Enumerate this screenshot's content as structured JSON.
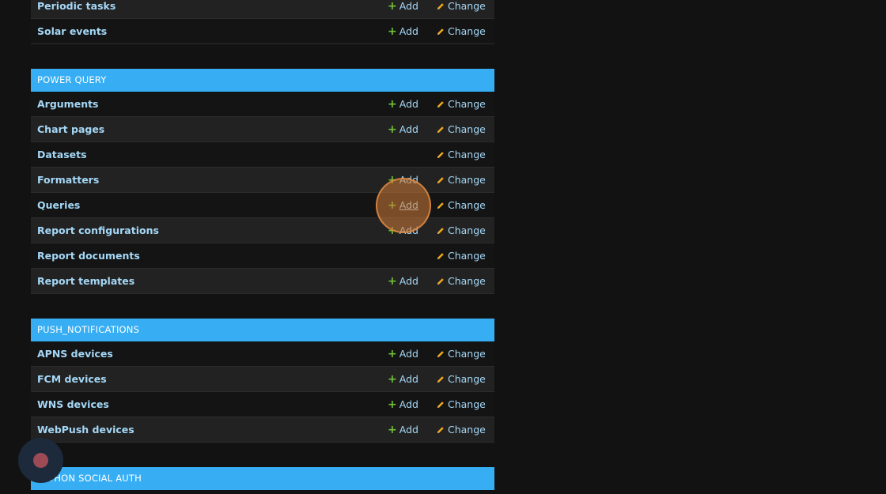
{
  "top_module": {
    "rows": [
      {
        "name": "Periodic tasks",
        "add": "Add",
        "change": "Change"
      },
      {
        "name": "Solar events",
        "add": "Add",
        "change": "Change"
      }
    ]
  },
  "power_query": {
    "title": "POWER QUERY",
    "rows": [
      {
        "name": "Arguments",
        "add": "Add",
        "change": "Change"
      },
      {
        "name": "Chart pages",
        "add": "Add",
        "change": "Change"
      },
      {
        "name": "Datasets",
        "change": "Change"
      },
      {
        "name": "Formatters",
        "add": "Add",
        "change": "Change"
      },
      {
        "name": "Queries",
        "add": "Add",
        "change": "Change"
      },
      {
        "name": "Report configurations",
        "add": "Add",
        "change": "Change"
      },
      {
        "name": "Report documents",
        "change": "Change"
      },
      {
        "name": "Report templates",
        "add": "Add",
        "change": "Change"
      }
    ]
  },
  "push_notifications": {
    "title": "PUSH_NOTIFICATIONS",
    "rows": [
      {
        "name": "APNS devices",
        "add": "Add",
        "change": "Change"
      },
      {
        "name": "FCM devices",
        "add": "Add",
        "change": "Change"
      },
      {
        "name": "WNS devices",
        "add": "Add",
        "change": "Change"
      },
      {
        "name": "WebPush devices",
        "add": "Add",
        "change": "Change"
      }
    ]
  },
  "python_social_auth": {
    "title": "PYTHON SOCIAL AUTH"
  },
  "colors": {
    "header_bg": "#37aef4",
    "link": "#a5d8f7",
    "add_icon": "#72c237",
    "change_icon": "#f0a91e",
    "page_bg": "#121212"
  },
  "icons": {
    "add": "plus-icon",
    "change": "pencil-icon",
    "recorder": "record-icon"
  }
}
